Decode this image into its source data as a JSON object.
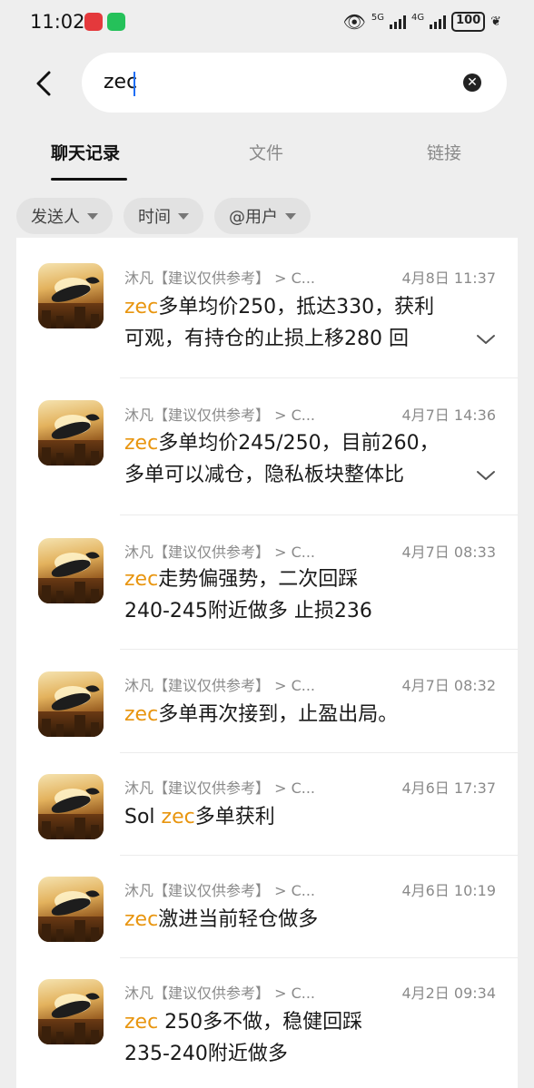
{
  "status": {
    "time": "11:02",
    "network_a": "5G",
    "network_b": "4G",
    "battery": "100"
  },
  "search": {
    "query": "zec"
  },
  "tabs": [
    {
      "label": "聊天记录",
      "active": true
    },
    {
      "label": "文件",
      "active": false
    },
    {
      "label": "链接",
      "active": false
    }
  ],
  "filters": [
    {
      "label": "发送人"
    },
    {
      "label": "时间"
    },
    {
      "label": "@用户"
    }
  ],
  "colors": {
    "highlight": "#e8950f",
    "caret": "#1e6ef5"
  },
  "messages": [
    {
      "sender": "沐凡【建议仅供参考】 > C...",
      "date": "4月8日 11:37",
      "pre": "",
      "keyword": "zec",
      "line1": "多单均价250，抵达330，获利",
      "line2": "可观，有持仓的止损上移280 回",
      "expandable": true
    },
    {
      "sender": "沐凡【建议仅供参考】 > C...",
      "date": "4月7日 14:36",
      "pre": "",
      "keyword": "zec",
      "line1": "多单均价245/250，目前260，",
      "line2": "多单可以减仓，隐私板块整体比",
      "expandable": true
    },
    {
      "sender": "沐凡【建议仅供参考】 > C...",
      "date": "4月7日 08:33",
      "pre": "",
      "keyword": "zec",
      "line1": "走势偏强势，二次回踩",
      "line2": "240-245附近做多 止损236",
      "expandable": false
    },
    {
      "sender": "沐凡【建议仅供参考】 > C...",
      "date": "4月7日 08:32",
      "pre": "",
      "keyword": "zec",
      "line1": "多单再次接到，止盈出局。",
      "line2": "",
      "expandable": false
    },
    {
      "sender": "沐凡【建议仅供参考】 > C...",
      "date": "4月6日 17:37",
      "pre": "Sol ",
      "keyword": "zec",
      "line1": "多单获利",
      "line2": "",
      "expandable": false
    },
    {
      "sender": "沐凡【建议仅供参考】 > C...",
      "date": "4月6日 10:19",
      "pre": "",
      "keyword": "zec",
      "line1": "激进当前轻仓做多",
      "line2": "",
      "expandable": false
    },
    {
      "sender": "沐凡【建议仅供参考】 > C...",
      "date": "4月2日 09:34",
      "pre": "",
      "keyword": "zec",
      "line1": " 250多不做，稳健回踩",
      "line2": "235-240附近做多",
      "expandable": false
    }
  ]
}
